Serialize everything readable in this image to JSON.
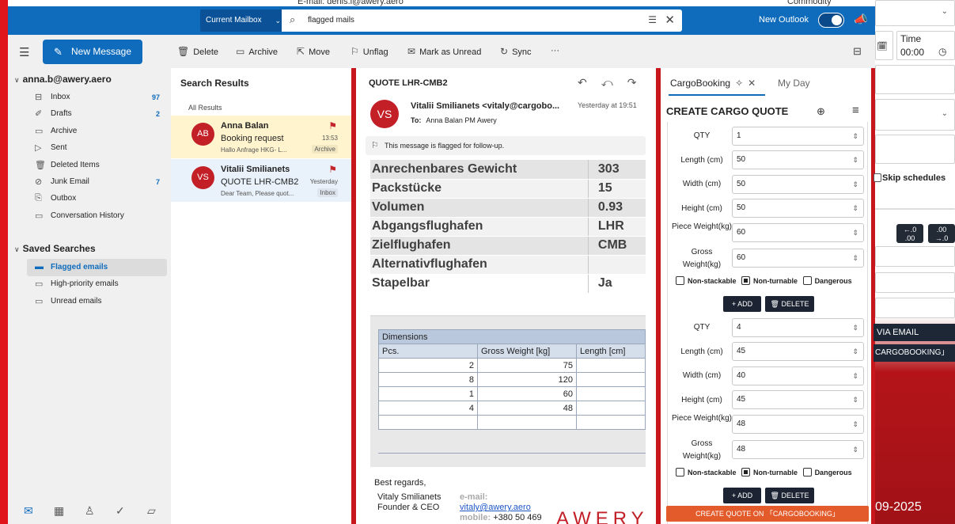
{
  "background": {
    "top_email_text": "E-mail: denis.i@awery.aero",
    "top_right_text": "Commodity",
    "time_label": "Time",
    "time_value": "00:00",
    "skip_schedules": "Skip schedules",
    "btn_decimals_dec": "←.0\n.00",
    "btn_decimals_inc": ".00\n→.0",
    "via_email": "VIA EMAIL",
    "cargobooking": "CARGOBOOKING」",
    "date_fragment": "09-2025"
  },
  "topbar": {
    "mailbox_label": "Current Mailbox",
    "search_value": "flagged mails",
    "new_outlook_label": "New Outlook",
    "new_outlook_on": true
  },
  "commands": {
    "new_message": "New Message",
    "delete": "Delete",
    "archive": "Archive",
    "move": "Move",
    "unflag": "Unflag",
    "mark_unread": "Mark as Unread",
    "sync": "Sync",
    "more": "···"
  },
  "nav": {
    "account": "anna.b@awery.aero",
    "folders": [
      {
        "label": "Inbox",
        "count": "97",
        "icon": "inbox-icon"
      },
      {
        "label": "Drafts",
        "count": "2",
        "icon": "drafts-icon"
      },
      {
        "label": "Archive",
        "count": "",
        "icon": "archive-icon"
      },
      {
        "label": "Sent",
        "count": "",
        "icon": "sent-icon"
      },
      {
        "label": "Deleted Items",
        "count": "",
        "icon": "trash-icon"
      },
      {
        "label": "Junk Email",
        "count": "7",
        "icon": "junk-icon"
      },
      {
        "label": "Outbox",
        "count": "",
        "icon": "outbox-icon"
      },
      {
        "label": "Conversation History",
        "count": "",
        "icon": "folder-icon"
      }
    ],
    "saved_title": "Saved Searches",
    "saved": [
      {
        "label": "Flagged emails",
        "selected": true
      },
      {
        "label": "High-priority emails",
        "selected": false
      },
      {
        "label": "Unread emails",
        "selected": false
      }
    ]
  },
  "list": {
    "title": "Search Results",
    "subtitle": "All Results",
    "messages": [
      {
        "initials": "AB",
        "sender": "Anna Balan",
        "subject": "Booking request",
        "preview": "Hallo Anfrage HKG- L...",
        "time": "13:53",
        "tag": "Archive"
      },
      {
        "initials": "VS",
        "sender": "Vitalii Smilianets",
        "subject": "QUOTE LHR-CMB2",
        "preview": "Dear Team, Please quot...",
        "time": "Yesterday",
        "tag": "Inbox"
      }
    ]
  },
  "reading": {
    "subject": "QUOTE LHR-CMB2",
    "avatar": "VS",
    "from": "Vitalii Smilianets <vitaly@cargobo...",
    "when": "Yesterday at 19:51",
    "to_label": "To:",
    "to": "Anna Balan PM Awery",
    "flag_notice": "This message is flagged for follow-up.",
    "details": [
      {
        "k": "Anrechenbares Gewicht",
        "v": "303"
      },
      {
        "k": "Packstücke",
        "v": "15"
      },
      {
        "k": "Volumen",
        "v": "0.93"
      },
      {
        "k": "Abgangsflughafen",
        "v": "LHR"
      },
      {
        "k": "Zielflughafen",
        "v": "CMB"
      },
      {
        "k": "Alternativflughafen",
        "v": ""
      },
      {
        "k": "Stapelbar",
        "v": "Ja"
      }
    ],
    "dims_title": "Dimensions",
    "dims_headers": [
      "Pcs.",
      "Gross Weight [kg]",
      "Length [cm]"
    ],
    "dims_rows": [
      [
        "2",
        "75",
        ""
      ],
      [
        "8",
        "120",
        ""
      ],
      [
        "1",
        "60",
        ""
      ],
      [
        "4",
        "48",
        ""
      ],
      [
        "",
        "",
        ""
      ]
    ],
    "signoff": "Best regards,",
    "sig_name": "Vitaly Smilianets",
    "sig_title": "Founder & CEO",
    "sig_email_label": "e-mail:",
    "sig_email": "vitaly@awery.aero",
    "sig_mobile_label": "mobile:",
    "sig_mobile": "+380 50 469",
    "sig_logo": "AWERY"
  },
  "panel": {
    "tab_active": "CargoBooking",
    "tab_other": "My Day",
    "heading": "CREATE CARGO QUOTE",
    "pieces": [
      {
        "qty": "1",
        "length": "50",
        "width": "50",
        "height": "50",
        "piece_weight": "60",
        "gross_weight": "60"
      },
      {
        "qty": "4",
        "length": "45",
        "width": "40",
        "height": "45",
        "piece_weight": "48",
        "gross_weight": "48"
      }
    ],
    "labels": {
      "qty": "QTY",
      "length": "Length (cm)",
      "width": "Width (cm)",
      "height": "Height (cm)",
      "piece_weight": "Piece Weight(kg)",
      "gross_weight": "Gross Weight(kg)",
      "non_stackable": "Non-stackable",
      "non_turnable": "Non-turnable",
      "dangerous": "Dangerous",
      "add": "+ ADD",
      "delete": "DELETE"
    },
    "create_button": "CREATE QUOTE ON 「CARGOBOOKING」"
  }
}
